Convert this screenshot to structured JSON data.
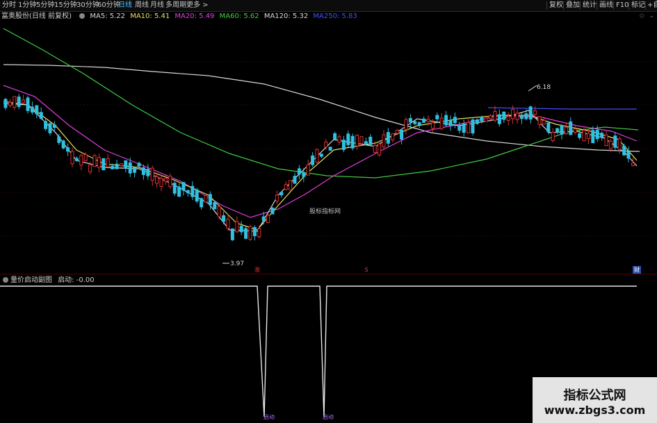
{
  "toolbar": {
    "periods": [
      "分时",
      "1分钟",
      "5分钟",
      "15分钟",
      "30分钟",
      "60分钟",
      "日线",
      "周线",
      "月线",
      "多周期",
      "更多"
    ],
    "active_period": "日线",
    "right_buttons": [
      "复权",
      "叠加",
      "统计",
      "画线",
      "F10",
      "标记",
      "+自"
    ]
  },
  "main_legend": {
    "stock": "富奥股份(日线 前复权)",
    "ma": [
      {
        "label": "MA5: 5.22",
        "color": "#d8d8d8"
      },
      {
        "label": "MA10: 5.41",
        "color": "#e8e060"
      },
      {
        "label": "MA20: 5.49",
        "color": "#e040e0"
      },
      {
        "label": "MA60: 5.62",
        "color": "#40d040"
      },
      {
        "label": "MA120: 5.32",
        "color": "#d8d8d8"
      },
      {
        "label": "MA250: 5.83",
        "color": "#4050ff"
      }
    ]
  },
  "annotations": {
    "high_label": "6.18",
    "low_label": "3.97",
    "watermark": "股标指标网",
    "badge_zhang": "涨",
    "badge_s": "S",
    "badge_cai": "财"
  },
  "indicator": {
    "name": "量价启动副图",
    "value_label": "启动: -0.00",
    "signal_label": "启动"
  },
  "site_watermark": {
    "title": "指标公式网",
    "url": "www.zbgs3.com"
  },
  "colors": {
    "up": "#e03030",
    "down": "#30c0e0",
    "ma5": "#d8d8d8",
    "ma10": "#e8e060",
    "ma20": "#e040e0",
    "ma60": "#40d040",
    "ma120": "#d8d8d8",
    "ma250": "#4050ff",
    "active_tab": "#4fc3ff"
  },
  "chart_data": {
    "type": "candlestick",
    "high": 6.18,
    "low": 3.97,
    "signals": 2
  }
}
